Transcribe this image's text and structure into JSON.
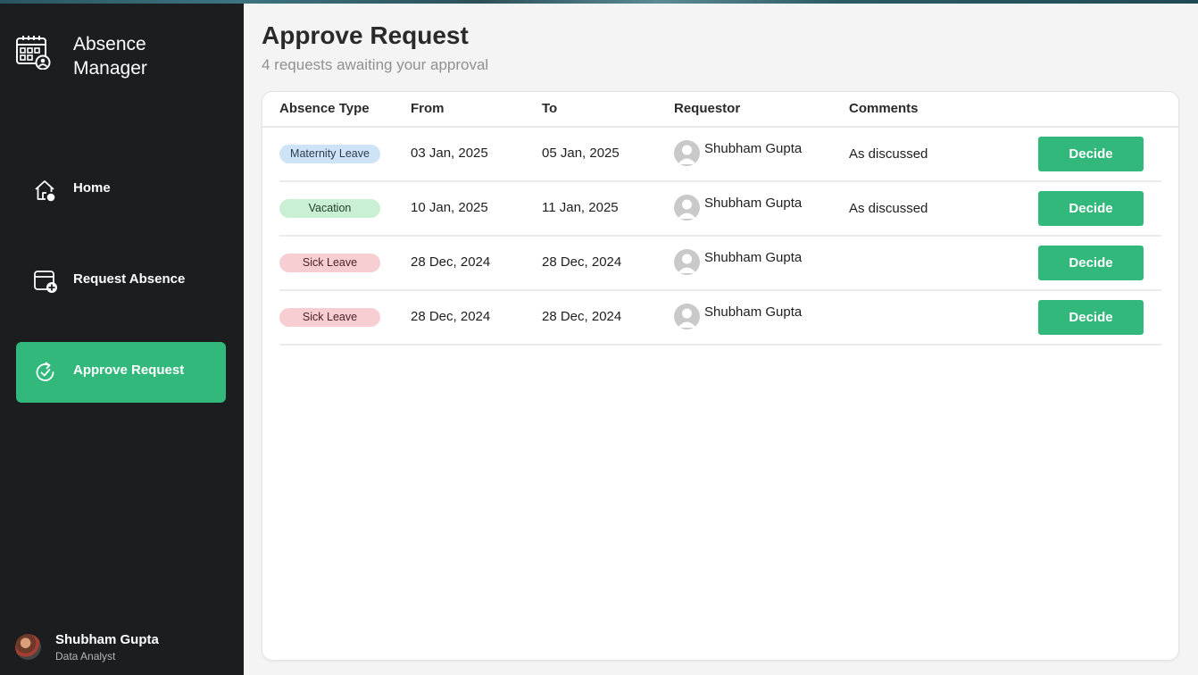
{
  "app": {
    "title": "Absence Manager",
    "title_line1": "Absence",
    "title_line2": "Manager",
    "logo_icon": "calendar-user-icon"
  },
  "sidebar": {
    "items": [
      {
        "label": "Home",
        "icon": "home-icon",
        "active": false
      },
      {
        "label": "Request Absence",
        "icon": "calendar-add-icon",
        "active": false
      },
      {
        "label": "Approve Request",
        "icon": "refresh-check-icon",
        "active": true
      }
    ],
    "user": {
      "name": "Shubham Gupta",
      "role": "Data Analyst"
    }
  },
  "page": {
    "title": "Approve Request",
    "subtitle": "4 requests awaiting your approval"
  },
  "table": {
    "columns": [
      "Absence Type",
      "From",
      "To",
      "Requestor",
      "Comments"
    ],
    "rows": [
      {
        "type": "Maternity Leave",
        "type_style": "maternity",
        "from": "03 Jan, 2025",
        "to": "05 Jan, 2025",
        "requestor": "Shubham Gupta",
        "comments": "As discussed",
        "action": "Decide"
      },
      {
        "type": "Vacation",
        "type_style": "vacation",
        "from": "10 Jan, 2025",
        "to": "11 Jan, 2025",
        "requestor": "Shubham Gupta",
        "comments": "As discussed",
        "action": "Decide"
      },
      {
        "type": "Sick Leave",
        "type_style": "sick",
        "from": "28 Dec, 2024",
        "to": "28 Dec, 2024",
        "requestor": "Shubham Gupta",
        "comments": "",
        "action": "Decide"
      },
      {
        "type": "Sick Leave",
        "type_style": "sick",
        "from": "28 Dec, 2024",
        "to": "28 Dec, 2024",
        "requestor": "Shubham Gupta",
        "comments": "",
        "action": "Decide"
      }
    ]
  },
  "colors": {
    "sidebar_bg": "#1c1d1f",
    "accent": "#33b87c",
    "maternity_pill": "#cfe3f7",
    "vacation_pill": "#c9f0d3",
    "sick_pill": "#f7cfd3"
  }
}
